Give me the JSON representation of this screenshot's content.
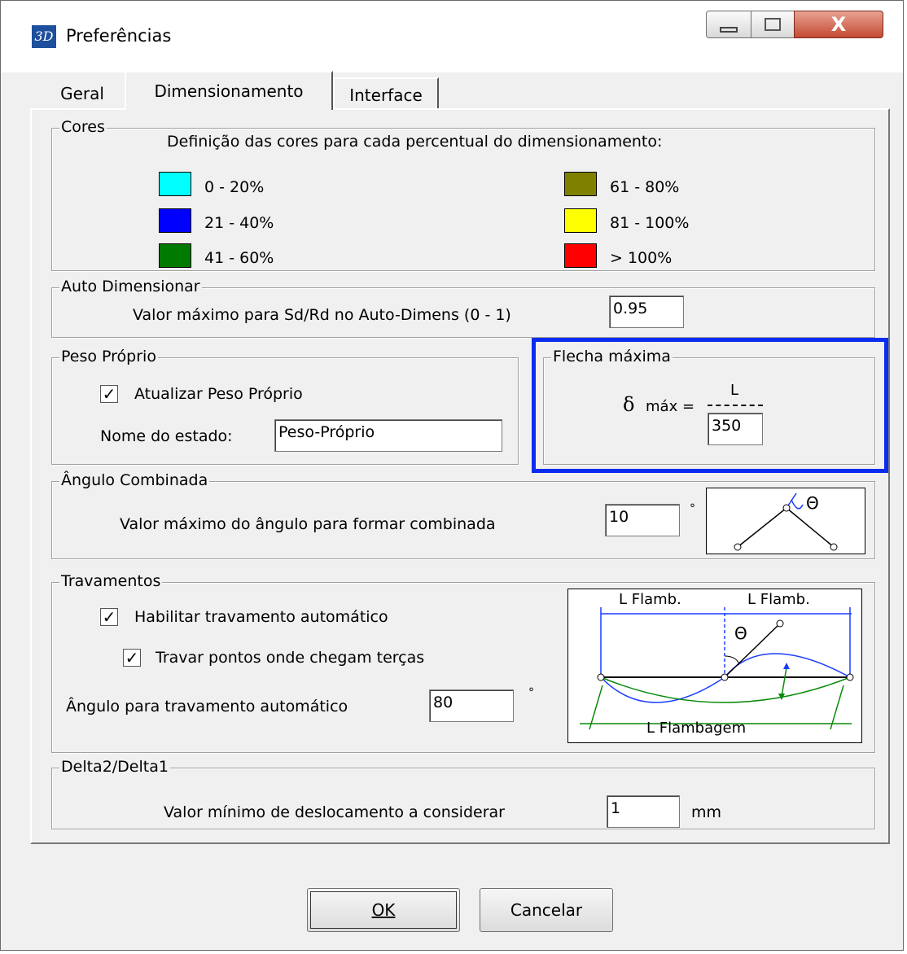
{
  "window": {
    "title": "Preferências",
    "app_icon_text": "3D",
    "close_glyph": "X"
  },
  "tabs": [
    "Geral",
    "Dimensionamento",
    "Interface"
  ],
  "cores": {
    "legend": "Cores",
    "description": "Definição das cores para cada percentual do dimensionamento:",
    "ranges": [
      {
        "label": "0 - 20%",
        "color": "#00ffff"
      },
      {
        "label": "21 - 40%",
        "color": "#0000ff"
      },
      {
        "label": "41 - 60%",
        "color": "#007a00"
      },
      {
        "label": "61 - 80%",
        "color": "#808000"
      },
      {
        "label": "81 - 100%",
        "color": "#ffff00"
      },
      {
        "label": "> 100%",
        "color": "#ff0000"
      }
    ]
  },
  "auto_dimensionar": {
    "legend": "Auto Dimensionar",
    "label": "Valor máximo para Sd/Rd no Auto-Dimens (0 - 1)",
    "value": "0.95"
  },
  "peso_proprio": {
    "legend": "Peso Próprio",
    "checkbox_label": "Atualizar Peso Próprio",
    "checked": true,
    "state_label": "Nome do estado:",
    "state_value": "Peso-Próprio"
  },
  "flecha_maxima": {
    "legend": "Flecha máxima",
    "delta_symbol": "δ",
    "formula_label": "máx =",
    "numerator": "L",
    "denominator_value": "350"
  },
  "angulo_combinada": {
    "legend": "Ângulo Combinada",
    "label": "Valor máximo do ângulo para formar combinada",
    "value": "10",
    "unit": "°",
    "theta": "Θ"
  },
  "travamentos": {
    "legend": "Travamentos",
    "auto_label": "Habilitar travamento automático",
    "auto_checked": true,
    "terca_label": "Travar pontos onde chegam terças",
    "terca_checked": true,
    "angle_label": "Ângulo para travamento automático",
    "angle_value": "80",
    "unit": "°",
    "diagram": {
      "l_flamb_left": "L Flamb.",
      "l_flamb_right": "L Flamb.",
      "l_flambagem": "L Flambagem",
      "theta": "Θ"
    }
  },
  "delta": {
    "legend": "Delta2/Delta1",
    "label": "Valor mínimo de deslocamento a considerar",
    "value": "1",
    "unit": "mm"
  },
  "buttons": {
    "ok": "OK",
    "cancel": "Cancelar"
  }
}
